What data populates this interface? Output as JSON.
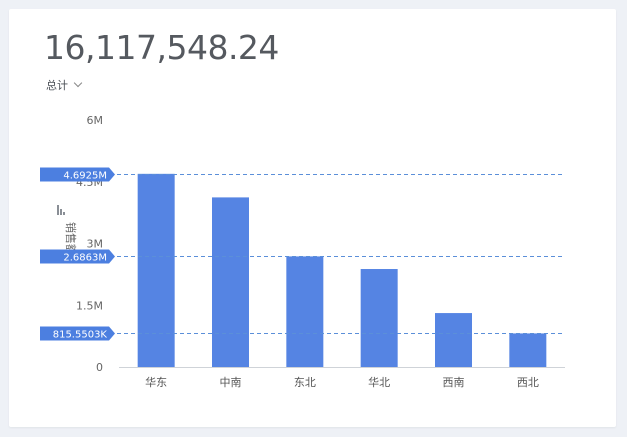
{
  "kpi": {
    "total_value": "16,117,548.24",
    "aggregation_label": "总计"
  },
  "colors": {
    "bar": "#5584e3",
    "ref_line": "#5b8fd9",
    "ref_label_bg": "#4c7fe0"
  },
  "icons": {
    "axis_label_icon": "bar-chart-icon",
    "dropdown_icon": "chevron-down-icon"
  },
  "chart_data": {
    "type": "bar",
    "categories": [
      "华东",
      "中南",
      "东北",
      "华北",
      "西南",
      "西北"
    ],
    "values": [
      4692500,
      4120000,
      2686300,
      2380000,
      1310000,
      815550
    ],
    "ylabel": "销售额",
    "ylim": [
      0,
      6000000
    ],
    "y_ticks": [
      {
        "value": 0,
        "label": "0"
      },
      {
        "value": 1500000,
        "label": "1.5M"
      },
      {
        "value": 3000000,
        "label": "3M"
      },
      {
        "value": 4500000,
        "label": "4.5M"
      },
      {
        "value": 6000000,
        "label": "6M"
      }
    ],
    "reference_lines": [
      {
        "value": 4692500,
        "label": "4.6925M"
      },
      {
        "value": 2686300,
        "label": "2.6863M"
      },
      {
        "value": 815550,
        "label": "815.5503K"
      }
    ],
    "grid": false
  }
}
